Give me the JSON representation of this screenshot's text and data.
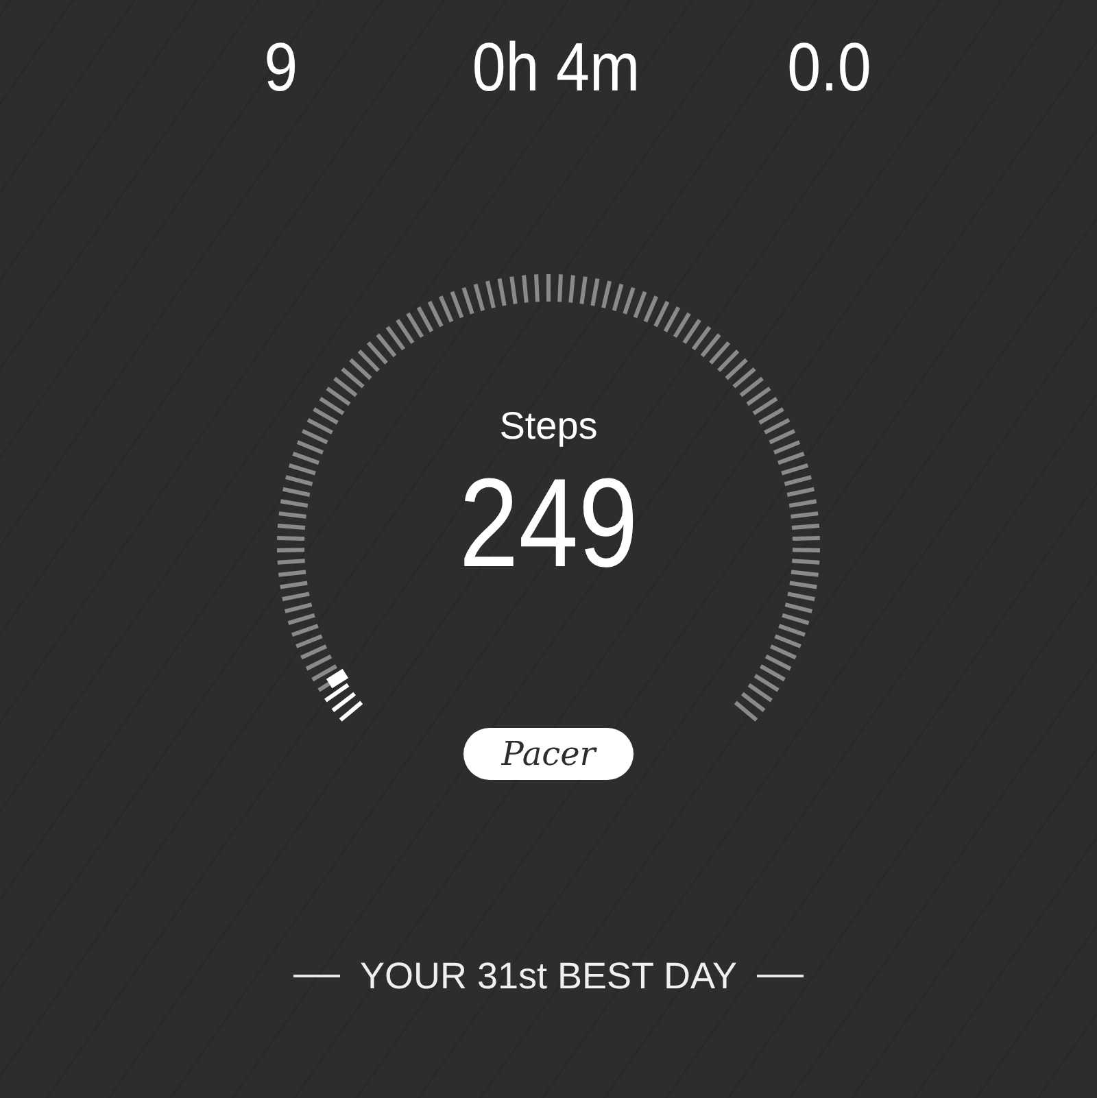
{
  "stats": [
    {
      "value": "9"
    },
    {
      "value": "0h 4m"
    },
    {
      "value": "0.0"
    }
  ],
  "gauge": {
    "label": "Steps",
    "value": "249"
  },
  "brand": "Pacer",
  "rank": "YOUR 31st BEST DAY"
}
